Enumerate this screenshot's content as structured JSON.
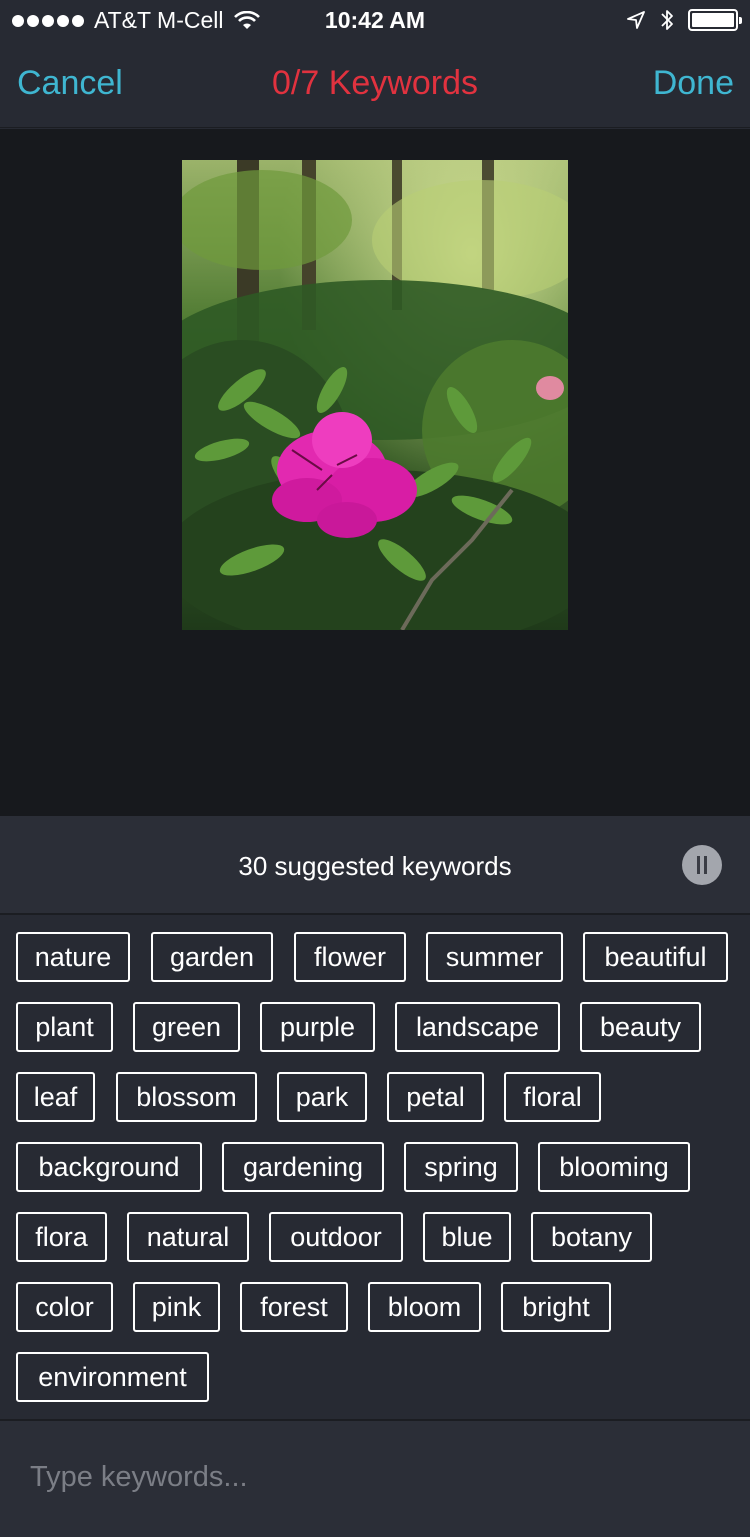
{
  "status_bar": {
    "carrier": "AT&T M-Cell",
    "time": "10:42 AM"
  },
  "nav": {
    "cancel_label": "Cancel",
    "title": "0/7 Keywords",
    "done_label": "Done"
  },
  "colors": {
    "accent": "#3fb6d1",
    "title_red": "#e1323f",
    "background": "#272a33",
    "photo_backdrop": "#17191d"
  },
  "suggestions": {
    "label": "30 suggested keywords",
    "keywords": [
      "nature",
      "garden",
      "flower",
      "summer",
      "beautiful",
      "plant",
      "green",
      "purple",
      "landscape",
      "beauty",
      "leaf",
      "blossom",
      "park",
      "petal",
      "floral",
      "background",
      "gardening",
      "spring",
      "blooming",
      "flora",
      "natural",
      "outdoor",
      "blue",
      "botany",
      "color",
      "pink",
      "forest",
      "bloom",
      "bright",
      "environment"
    ]
  },
  "input": {
    "placeholder": "Type keywords...",
    "value": ""
  }
}
